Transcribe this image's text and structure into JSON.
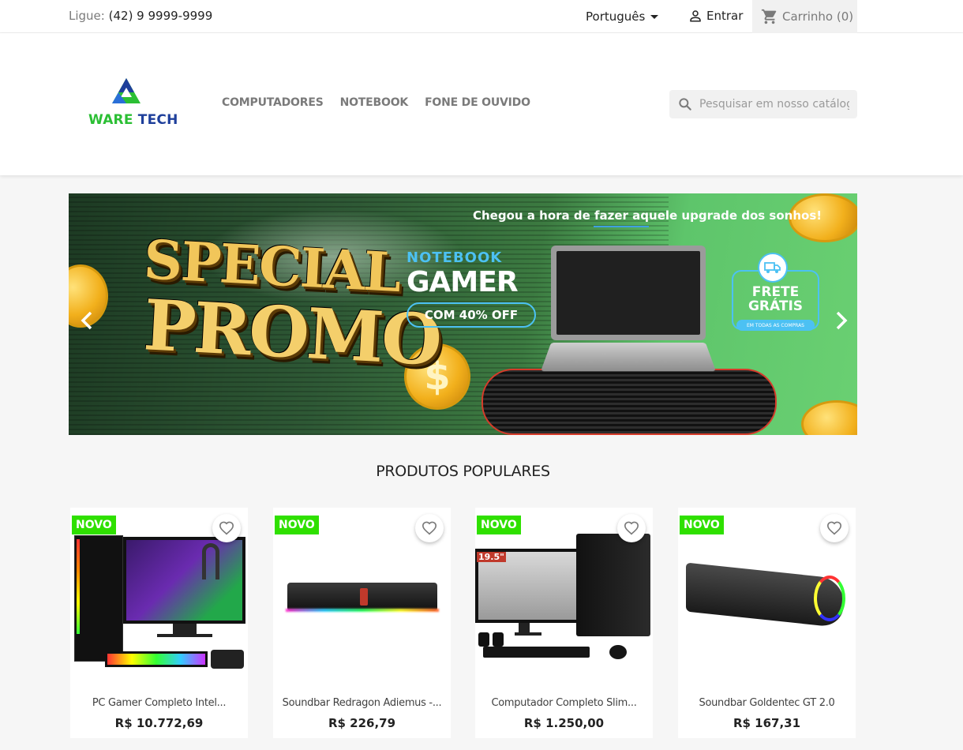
{
  "topbar": {
    "phone_label": "Ligue:",
    "phone_number": "(42) 9 9999-9999",
    "language": "Português",
    "login": "Entrar",
    "cart": "Carrinho (0)"
  },
  "header": {
    "logo_word1": "WARE",
    "logo_word2": "TECH",
    "nav": [
      "COMPUTADORES",
      "NOTEBOOK",
      "FONE DE OUVIDO"
    ],
    "search_placeholder": "Pesquisar em nosso catálogo"
  },
  "banner": {
    "tagline": "Chegou a hora de fazer aquele upgrade dos sonhos!",
    "promo_line1": "SPECIAL",
    "promo_line2": "PROMO",
    "notebook": "NOTEBOOK",
    "gamer": "GAMER",
    "discount": "COM 40% OFF",
    "frete_line1": "FRETE",
    "frete_line2": "GRÁTIS",
    "frete_sub": "EM TODAS AS COMPRAS",
    "coin_symbol": "$"
  },
  "products": {
    "title": "PRODUTOS POPULARES",
    "items": [
      {
        "badge": "NOVO",
        "name": "PC Gamer Completo Intel...",
        "price": "R$ 10.772,69"
      },
      {
        "badge": "NOVO",
        "name": "Soundbar Redragon Adiemus -...",
        "price": "R$ 226,79"
      },
      {
        "badge": "NOVO",
        "name": "Computador Completo Slim...",
        "price": "R$ 1.250,00"
      },
      {
        "badge": "NOVO",
        "name": "Soundbar Goldentec GT 2.0",
        "price": "R$ 167,31"
      }
    ],
    "monitor_label": "19.5\""
  },
  "colors": {
    "accent_green": "#2fe000",
    "brand_green": "#2bbf34",
    "brand_blue": "#1e3f9b",
    "banner_blue": "#4cc1f3"
  }
}
